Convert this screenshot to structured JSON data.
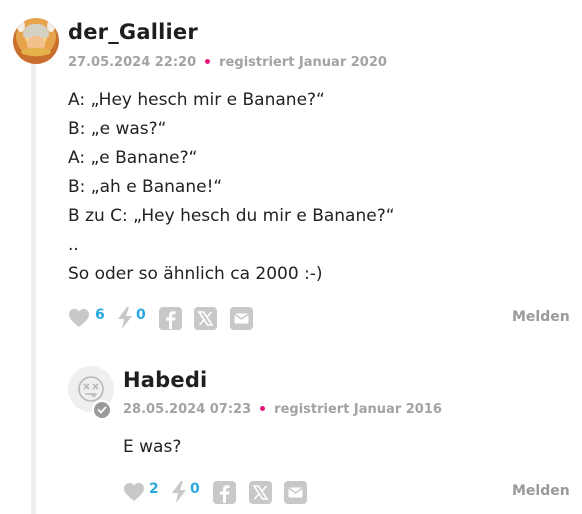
{
  "comments": [
    {
      "username": "der_Gallier",
      "timestamp": "27.05.2024 22:20",
      "registered": "registriert Januar 2020",
      "lines": [
        "A: „Hey hesch mir e Banane?“",
        "B: „e was?“",
        "A: „e Banane?“",
        "B: „ah e Banane!“",
        "B zu C: „Hey hesch du mir e Banane?“",
        "..",
        "So oder so ähnlich ca 2000 :-)"
      ],
      "likes": "6",
      "flashes": "0",
      "report_label": "Melden"
    },
    {
      "username": "Habedi",
      "timestamp": "28.05.2024 07:23",
      "registered": "registriert Januar 2016",
      "lines": [
        "E was?"
      ],
      "likes": "2",
      "flashes": "0",
      "report_label": "Melden"
    }
  ],
  "icons": {
    "like": "heart-icon",
    "flash": "lightning-icon",
    "share_facebook": "facebook-icon",
    "share_x": "x-icon",
    "share_mail": "mail-icon",
    "verified": "checkmark-badge-icon"
  },
  "colors": {
    "accent_count": "#2aa8e0",
    "meta_dot": "#e6177c",
    "icon_gray": "#c8c8c8"
  }
}
